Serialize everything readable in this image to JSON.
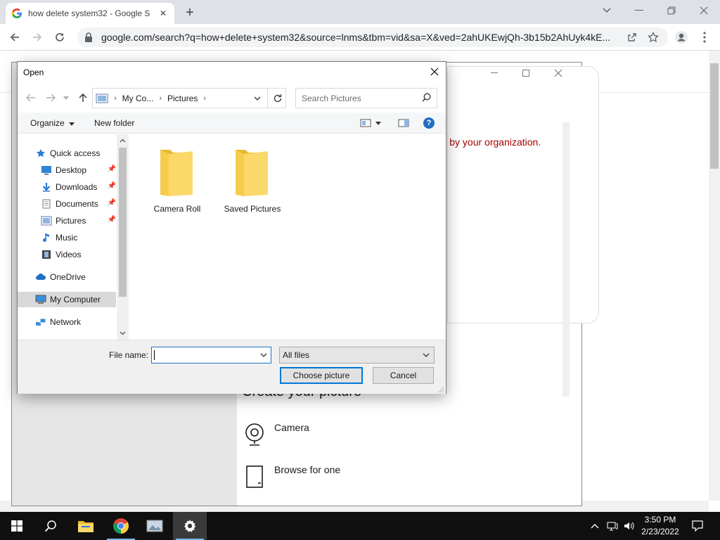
{
  "browser": {
    "tab_title": "how delete system32 - Google S",
    "url": "google.com/search?q=how+delete+system32&source=lnms&tbm=vid&sa=X&ved=2ahUKEwjQh-3b15b2AhUyk4kE..."
  },
  "settings_window": {
    "org_warning": "ged by your organization.",
    "create_heading": "Create your picture",
    "options": [
      {
        "label": "Camera",
        "icon": "webcam-icon"
      },
      {
        "label": "Browse for one",
        "icon": "document-icon"
      }
    ]
  },
  "dialog": {
    "title": "Open",
    "breadcrumb": [
      "My Co...",
      "Pictures"
    ],
    "search_placeholder": "Search Pictures",
    "commands": {
      "organize": "Organize",
      "new_folder": "New folder"
    },
    "nav_items": [
      {
        "label": "Quick access",
        "icon": "star-icon",
        "pinned": false
      },
      {
        "label": "Desktop",
        "icon": "desktop-icon",
        "pinned": true
      },
      {
        "label": "Downloads",
        "icon": "download-icon",
        "pinned": true
      },
      {
        "label": "Documents",
        "icon": "documents-icon",
        "pinned": true
      },
      {
        "label": "Pictures",
        "icon": "pictures-icon",
        "pinned": true
      },
      {
        "label": "Music",
        "icon": "music-icon",
        "pinned": false
      },
      {
        "label": "Videos",
        "icon": "video-icon",
        "pinned": false
      },
      {
        "label": "OneDrive",
        "icon": "cloud-icon",
        "pinned": false
      },
      {
        "label": "My Computer",
        "icon": "computer-icon",
        "pinned": false,
        "selected": true
      },
      {
        "label": "Network",
        "icon": "network-icon",
        "pinned": false
      }
    ],
    "folders": [
      {
        "label": "Camera Roll"
      },
      {
        "label": "Saved Pictures"
      }
    ],
    "file_name_label": "File name:",
    "file_name_value": "",
    "file_type": "All files",
    "choose_button": "Choose picture",
    "cancel_button": "Cancel"
  },
  "taskbar": {
    "time": "3:50 PM",
    "date": "2/23/2022"
  }
}
